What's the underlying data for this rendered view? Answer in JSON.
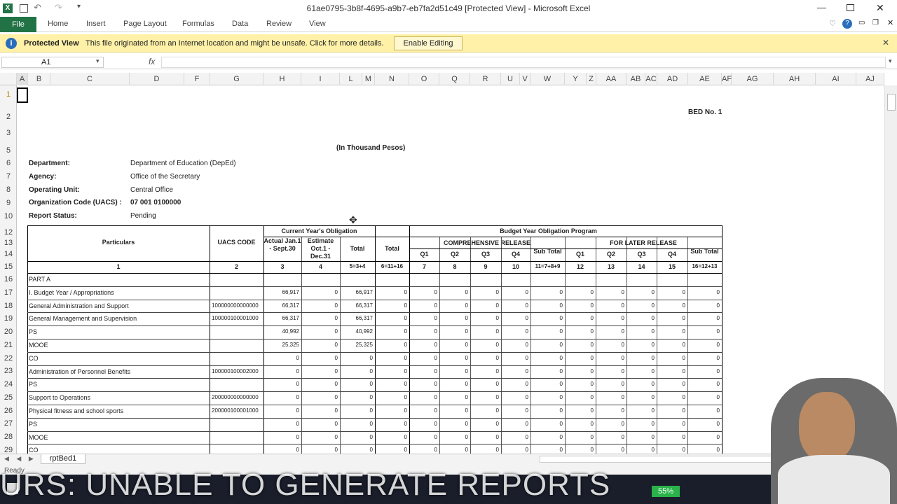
{
  "window": {
    "title": "61ae0795-3b8f-4695-a9b7-eb7fa2d51c49  [Protected View]  -  Microsoft Excel"
  },
  "ribbon": {
    "file": "File",
    "tabs": [
      "Home",
      "Insert",
      "Page Layout",
      "Formulas",
      "Data",
      "Review",
      "View"
    ]
  },
  "protected_view": {
    "label": "Protected View",
    "message": "This file originated from an Internet location and might be unsafe. Click for more details.",
    "button": "Enable Editing"
  },
  "name_box": {
    "value": "A1"
  },
  "formula_bar": {
    "icon": "fx-icon",
    "value": ""
  },
  "columns": [
    "A",
    "B",
    "C",
    "D",
    "F",
    "G",
    "H",
    "I",
    "L",
    "M",
    "N",
    "O",
    "Q",
    "R",
    "U",
    "V",
    "W",
    "Y",
    "Z",
    "AA",
    "AB",
    "AC",
    "AD",
    "AE",
    "AF",
    "AG",
    "AH",
    "AI",
    "AJ"
  ],
  "rows": [
    "1",
    "2",
    "3",
    "5",
    "6",
    "7",
    "8",
    "9",
    "10",
    "12",
    "13",
    "14",
    "15",
    "16",
    "17",
    "18",
    "19",
    "20",
    "21",
    "22",
    "23",
    "24",
    "25",
    "26",
    "27",
    "28",
    "29"
  ],
  "report": {
    "bed_no": "BED No. 1",
    "unit_note": "(In Thousand Pesos)",
    "department_label": "Department:",
    "department": "Department of Education (DepEd)",
    "agency_label": "Agency:",
    "agency": "Office of the Secretary",
    "operating_unit_label": "Operating Unit:",
    "operating_unit": "Central Office",
    "org_code_label": "Organization Code (UACS) :",
    "org_code": "07 001 0100000",
    "status_label": "Report Status:",
    "status": "Pending"
  },
  "table": {
    "h_particulars": "Particulars",
    "h_uacs": "UACS CODE",
    "h_current": "Current Year's Obligation",
    "h_actual": "Actual Jan.1 - Sept.30",
    "h_estimate": "Estimate Oct.1 - Dec.31",
    "h_total": "Total",
    "h_total2": "Total",
    "h_budget": "Budget Year Obligation Program",
    "h_comp": "COMPREHENSIVE RELEASE",
    "h_later": "FOR LATER RELEASE",
    "h_q": [
      "Q1",
      "Q2",
      "Q3",
      "Q4",
      "Sub Total",
      "Q1",
      "Q2",
      "Q3",
      "Q4",
      "Sub Total"
    ],
    "idx": [
      "1",
      "2",
      "3",
      "4",
      "5=3+4",
      "6=11+16",
      "7",
      "8",
      "9",
      "10",
      "11=7+8+9",
      "12",
      "13",
      "14",
      "15",
      "16=12+13"
    ],
    "rows": [
      {
        "p": "PART A",
        "u": "",
        "v": [
          "",
          "",
          "",
          "",
          "",
          "",
          "",
          "",
          "",
          "",
          "",
          "",
          "",
          ""
        ]
      },
      {
        "p": "I. Budget Year / Appropriations",
        "u": "",
        "v": [
          "66,917",
          "0",
          "66,917",
          "0",
          "0",
          "0",
          "0",
          "0",
          "0",
          "0",
          "0",
          "0",
          "0",
          "0"
        ]
      },
      {
        "p": "General Administration and Support",
        "u": "100000000000000",
        "v": [
          "66,317",
          "0",
          "66,317",
          "0",
          "0",
          "0",
          "0",
          "0",
          "0",
          "0",
          "0",
          "0",
          "0",
          "0"
        ]
      },
      {
        "p": "General Management and Supervision",
        "u": "100000100001000",
        "v": [
          "66,317",
          "0",
          "66,317",
          "0",
          "0",
          "0",
          "0",
          "0",
          "0",
          "0",
          "0",
          "0",
          "0",
          "0"
        ]
      },
      {
        "p": "PS",
        "u": "",
        "v": [
          "40,992",
          "0",
          "40,992",
          "0",
          "0",
          "0",
          "0",
          "0",
          "0",
          "0",
          "0",
          "0",
          "0",
          "0"
        ]
      },
      {
        "p": "MOOE",
        "u": "",
        "v": [
          "25,325",
          "0",
          "25,325",
          "0",
          "0",
          "0",
          "0",
          "0",
          "0",
          "0",
          "0",
          "0",
          "0",
          "0"
        ]
      },
      {
        "p": "CO",
        "u": "",
        "v": [
          "0",
          "0",
          "0",
          "0",
          "0",
          "0",
          "0",
          "0",
          "0",
          "0",
          "0",
          "0",
          "0",
          "0"
        ]
      },
      {
        "p": "Administration of Personnel Benefits",
        "u": "100000100002000",
        "v": [
          "0",
          "0",
          "0",
          "0",
          "0",
          "0",
          "0",
          "0",
          "0",
          "0",
          "0",
          "0",
          "0",
          "0"
        ]
      },
      {
        "p": "PS",
        "u": "",
        "v": [
          "0",
          "0",
          "0",
          "0",
          "0",
          "0",
          "0",
          "0",
          "0",
          "0",
          "0",
          "0",
          "0",
          "0"
        ]
      },
      {
        "p": "Support to Operations",
        "u": "200000000000000",
        "v": [
          "0",
          "0",
          "0",
          "0",
          "0",
          "0",
          "0",
          "0",
          "0",
          "0",
          "0",
          "0",
          "0",
          "0"
        ]
      },
      {
        "p": "Physical fitness and school sports",
        "u": "200000100001000",
        "v": [
          "0",
          "0",
          "0",
          "0",
          "0",
          "0",
          "0",
          "0",
          "0",
          "0",
          "0",
          "0",
          "0",
          "0"
        ]
      },
      {
        "p": "PS",
        "u": "",
        "v": [
          "0",
          "0",
          "0",
          "0",
          "0",
          "0",
          "0",
          "0",
          "0",
          "0",
          "0",
          "0",
          "0",
          "0"
        ]
      },
      {
        "p": "MOOE",
        "u": "",
        "v": [
          "0",
          "0",
          "0",
          "0",
          "0",
          "0",
          "0",
          "0",
          "0",
          "0",
          "0",
          "0",
          "0",
          "0"
        ]
      },
      {
        "p": "CO",
        "u": "",
        "v": [
          "0",
          "0",
          "0",
          "0",
          "0",
          "0",
          "0",
          "0",
          "0",
          "0",
          "0",
          "0",
          "0",
          "0"
        ]
      }
    ]
  },
  "sheet_tab": "rptBed1",
  "status_bar": {
    "ready": "Ready"
  },
  "taskbar": {
    "battery": "55%"
  },
  "banner": "URS: UNABLE TO GENERATE REPORTS"
}
